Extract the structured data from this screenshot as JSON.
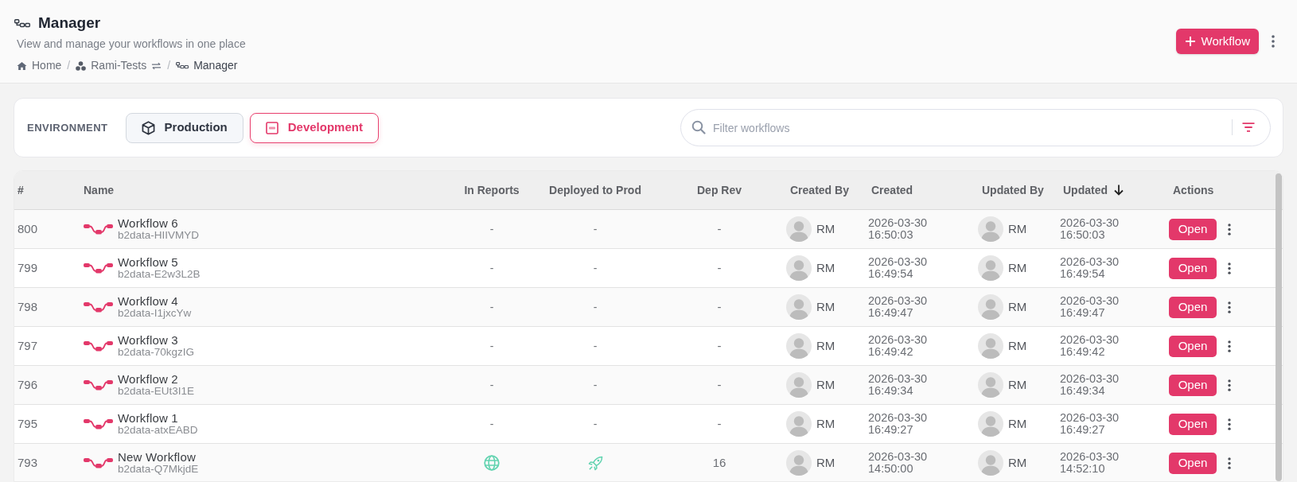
{
  "header": {
    "title": "Manager",
    "subtitle": "View and manage your workflows in one place",
    "breadcrumb": {
      "separator": "/",
      "items": [
        {
          "label": "Home",
          "kind": "home",
          "current": false
        },
        {
          "label": "Rami-Tests",
          "kind": "project",
          "current": false
        },
        {
          "label": "Manager",
          "kind": "workflows",
          "current": true
        }
      ]
    },
    "new_button": "Workflow"
  },
  "environment": {
    "label": "ENVIRONMENT",
    "options": [
      {
        "label": "Production",
        "kind": "cube",
        "selected": false
      },
      {
        "label": "Development",
        "kind": "dev",
        "selected": true
      }
    ]
  },
  "search": {
    "placeholder": "Filter workflows"
  },
  "table": {
    "columns": [
      {
        "label": "#",
        "sorted": false
      },
      {
        "label": "Name",
        "sorted": false
      },
      {
        "label": "In Reports",
        "sorted": false
      },
      {
        "label": "Deployed to Prod",
        "sorted": false
      },
      {
        "label": "Dep Rev",
        "sorted": false
      },
      {
        "label": "Created By",
        "sorted": false
      },
      {
        "label": "Created",
        "sorted": false
      },
      {
        "label": "Updated By",
        "sorted": false
      },
      {
        "label": "Updated",
        "sorted": true
      },
      {
        "label": "Actions",
        "sorted": false
      }
    ],
    "rows": [
      {
        "number": "800",
        "name": "Workflow 6",
        "key": "b2data-HIIVMYD",
        "in_reports": {
          "kind": "text",
          "text": "-"
        },
        "deployed": {
          "kind": "text",
          "text": "-"
        },
        "dep_rev": "-",
        "created_by": "RM",
        "created": "2026-03-30 16:50:03",
        "updated_by": "RM",
        "updated": "2026-03-30 16:50:03",
        "action": "Open"
      },
      {
        "number": "799",
        "name": "Workflow 5",
        "key": "b2data-E2w3L2B",
        "in_reports": {
          "kind": "text",
          "text": "-"
        },
        "deployed": {
          "kind": "text",
          "text": "-"
        },
        "dep_rev": "-",
        "created_by": "RM",
        "created": "2026-03-30 16:49:54",
        "updated_by": "RM",
        "updated": "2026-03-30 16:49:54",
        "action": "Open"
      },
      {
        "number": "798",
        "name": "Workflow 4",
        "key": "b2data-I1jxcYw",
        "in_reports": {
          "kind": "text",
          "text": "-"
        },
        "deployed": {
          "kind": "text",
          "text": "-"
        },
        "dep_rev": "-",
        "created_by": "RM",
        "created": "2026-03-30 16:49:47",
        "updated_by": "RM",
        "updated": "2026-03-30 16:49:47",
        "action": "Open"
      },
      {
        "number": "797",
        "name": "Workflow 3",
        "key": "b2data-70kgzIG",
        "in_reports": {
          "kind": "text",
          "text": "-"
        },
        "deployed": {
          "kind": "text",
          "text": "-"
        },
        "dep_rev": "-",
        "created_by": "RM",
        "created": "2026-03-30 16:49:42",
        "updated_by": "RM",
        "updated": "2026-03-30 16:49:42",
        "action": "Open"
      },
      {
        "number": "796",
        "name": "Workflow 2",
        "key": "b2data-EUt3I1E",
        "in_reports": {
          "kind": "text",
          "text": "-"
        },
        "deployed": {
          "kind": "text",
          "text": "-"
        },
        "dep_rev": "-",
        "created_by": "RM",
        "created": "2026-03-30 16:49:34",
        "updated_by": "RM",
        "updated": "2026-03-30 16:49:34",
        "action": "Open"
      },
      {
        "number": "795",
        "name": "Workflow 1",
        "key": "b2data-atxEABD",
        "in_reports": {
          "kind": "text",
          "text": "-"
        },
        "deployed": {
          "kind": "text",
          "text": "-"
        },
        "dep_rev": "-",
        "created_by": "RM",
        "created": "2026-03-30 16:49:27",
        "updated_by": "RM",
        "updated": "2026-03-30 16:49:27",
        "action": "Open"
      },
      {
        "number": "793",
        "name": "New Workflow",
        "key": "b2data-Q7MkjdE",
        "in_reports": {
          "kind": "icon"
        },
        "deployed": {
          "kind": "icon"
        },
        "dep_rev": "16",
        "created_by": "RM",
        "created": "2026-03-30 14:50:00",
        "updated_by": "RM",
        "updated": "2026-03-30 14:52:10",
        "action": "Open"
      }
    ]
  }
}
